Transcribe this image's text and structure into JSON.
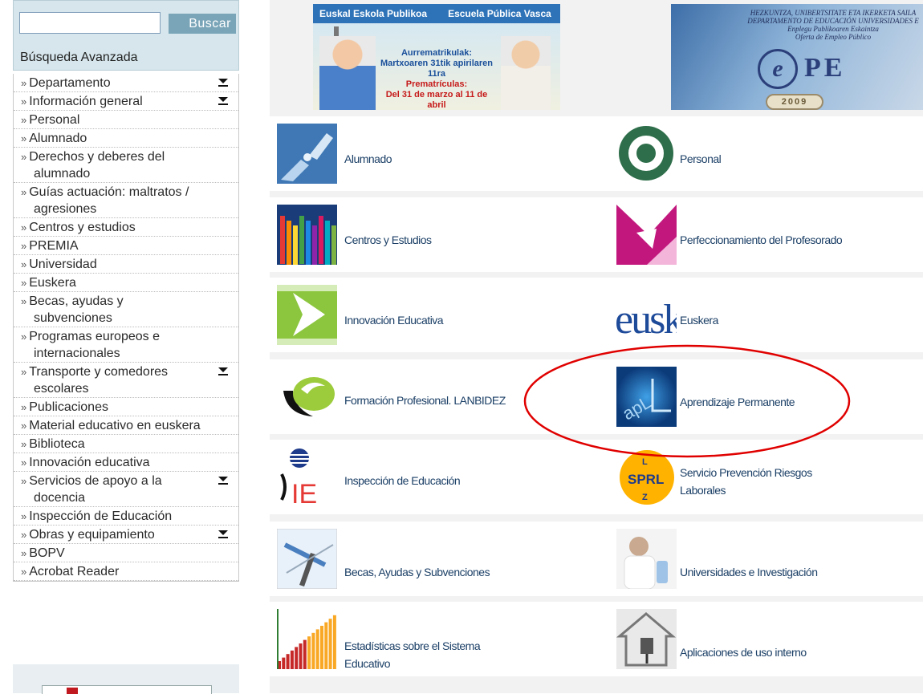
{
  "search": {
    "placeholder": "",
    "button_label": "Buscar",
    "advanced_label": "Búsqueda Avanzada"
  },
  "menu": {
    "items": [
      {
        "lines": [
          "Departamento"
        ],
        "has_arrow": true
      },
      {
        "lines": [
          "Información general"
        ],
        "has_arrow": true
      },
      {
        "lines": [
          "Personal"
        ],
        "has_arrow": false
      },
      {
        "lines": [
          "Alumnado"
        ],
        "has_arrow": false
      },
      {
        "lines": [
          "Derechos y deberes del",
          "alumnado"
        ],
        "has_arrow": false
      },
      {
        "lines": [
          "Guías actuación: maltratos /",
          "agresiones"
        ],
        "has_arrow": false
      },
      {
        "lines": [
          "Centros y estudios"
        ],
        "has_arrow": false
      },
      {
        "lines": [
          "PREMIA"
        ],
        "has_arrow": false
      },
      {
        "lines": [
          "Universidad"
        ],
        "has_arrow": false
      },
      {
        "lines": [
          "Euskera"
        ],
        "has_arrow": false
      },
      {
        "lines": [
          "Becas, ayudas y",
          "subvenciones"
        ],
        "has_arrow": false
      },
      {
        "lines": [
          "Programas europeos e",
          "internacionales"
        ],
        "has_arrow": false
      },
      {
        "lines": [
          "Transporte y comedores",
          "escolares"
        ],
        "has_arrow": true
      },
      {
        "lines": [
          "Publicaciones"
        ],
        "has_arrow": false
      },
      {
        "lines": [
          "Material educativo en euskera"
        ],
        "has_arrow": false
      },
      {
        "lines": [
          "Biblioteca"
        ],
        "has_arrow": false
      },
      {
        "lines": [
          "Innovación educativa"
        ],
        "has_arrow": false
      },
      {
        "lines": [
          "Servicios de apoyo a la",
          "docencia"
        ],
        "has_arrow": true
      },
      {
        "lines": [
          "Inspección de Educación"
        ],
        "has_arrow": false
      },
      {
        "lines": [
          "Obras y equipamiento"
        ],
        "has_arrow": true
      },
      {
        "lines": [
          "BOPV"
        ],
        "has_arrow": false
      },
      {
        "lines": [
          "Acrobat Reader"
        ],
        "has_arrow": false
      }
    ]
  },
  "banners": {
    "escuela": {
      "left_title": "Euskal Eskola Publikoa",
      "right_title": "Escuela Pública Vasca",
      "line1": "Aurrematrikulak:",
      "line2": "Martxoaren 31tik apirilaren 11ra",
      "line3": "Prematrículas:",
      "line4": "Del 31 de marzo al 11 de abril"
    },
    "ope": {
      "line1": "HEZKUNTZA, UNIBERTSITATE ETA IKERKETA SAILA",
      "line2": "DEPARTAMENTO DE EDUCACIÓN UNIVERSIDADES E",
      "line3": "Enplegu Publikoaren Eskaintza",
      "line4": "Oferta de Empleo Público",
      "logo_e": "e",
      "logo_pe": "PE",
      "year": "2009"
    }
  },
  "tiles": {
    "rows": [
      {
        "left": {
          "label": [
            "Alumnado"
          ],
          "icon": "hands-icon"
        },
        "right": {
          "label": [
            "Personal"
          ],
          "icon": "at-sign-icon"
        }
      },
      {
        "left": {
          "label": [
            "Centros y Estudios"
          ],
          "icon": "colored-pencils-icon"
        },
        "right": {
          "label": [
            "Perfeccionamiento del Profesorado"
          ],
          "icon": "magenta-shape-icon"
        }
      },
      {
        "left": {
          "label": [
            "Innovación Educativa"
          ],
          "icon": "green-arrows-icon"
        },
        "right": {
          "label": [
            "Euskera"
          ],
          "icon": "eusk-text-icon",
          "icon_text": "eusk"
        }
      },
      {
        "left": {
          "label": [
            "Formación Profesional. LANBIDEZ"
          ],
          "icon": "lanbidez-logo-icon"
        },
        "right": {
          "label": [
            "Aprendizaje Permanente"
          ],
          "icon": "apl-icon",
          "icon_text": "apL"
        }
      },
      {
        "left": {
          "label": [
            "Inspección de Educación"
          ],
          "icon": "ie-logo-icon",
          "icon_text": "IE"
        },
        "right": {
          "label": [
            "Servicio Prevención Riesgos",
            "Laborales"
          ],
          "icon": "sprl-logo-icon",
          "icon_text": "SPRL"
        }
      },
      {
        "left": {
          "label": [
            "Becas, Ayudas y Subvenciones"
          ],
          "icon": "pen-ruler-icon"
        },
        "right": {
          "label": [
            "Universidades e Investigación"
          ],
          "icon": "researcher-icon"
        }
      },
      {
        "left": {
          "label": [
            "Estadísticas sobre el Sistema",
            "Educativo"
          ],
          "icon": "bar-stats-icon"
        },
        "right": {
          "label": [
            "Aplicaciones de uso interno"
          ],
          "icon": "house-cable-icon"
        }
      }
    ]
  },
  "colors": {
    "accent": "#7aa5b8",
    "link": "#1b3f66",
    "highlight": "#e00000",
    "row_gap": "#e6e6e6"
  }
}
